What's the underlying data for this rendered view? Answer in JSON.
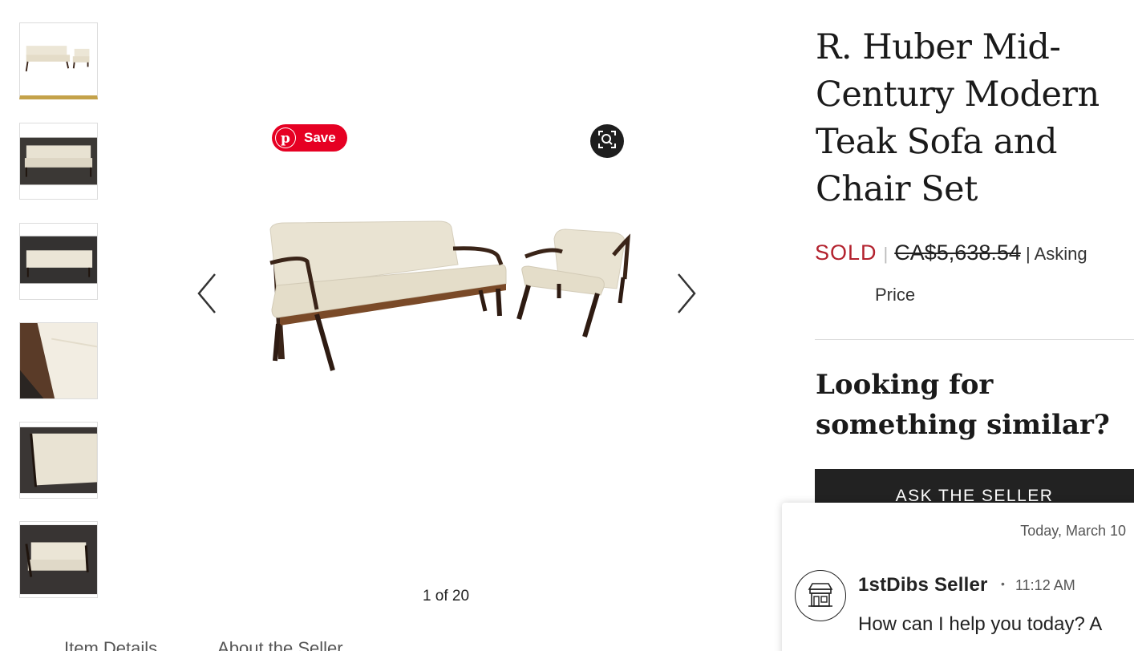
{
  "gallery": {
    "thumbnails": [
      {
        "label": "Sofa and chair set, white background",
        "active": true
      },
      {
        "label": "Sofa front view"
      },
      {
        "label": "Sofa flat view"
      },
      {
        "label": "Upholstery close-up"
      },
      {
        "label": "Sofa back detail"
      },
      {
        "label": "Sofa angle view"
      }
    ],
    "pinterest_save_label": "Save",
    "counter": "1 of 20",
    "tabs_peek": [
      "Item Details",
      "About the Seller"
    ]
  },
  "product": {
    "title": "R. Huber Mid-Century Modern Teak Sofa and Chair Set",
    "status": "SOLD",
    "price": "CA$5,638.54",
    "price_note_1": "| Asking",
    "price_note_2": "Price",
    "similar_heading": "Looking for something similar?",
    "ask_button": "ASK THE SELLER"
  },
  "chat": {
    "date": "Today, March 10",
    "seller_name": "1stDibs Seller",
    "dot": "•",
    "time": "11:12 AM",
    "message": "How can I help you today? A"
  },
  "colors": {
    "sold_red": "#b3222e",
    "pinterest_red": "#e60023",
    "active_thumb_gold": "#c4a24a",
    "button_dark": "#222222"
  },
  "icons": {
    "zoom": "zoom-magnifier-icon",
    "prev": "chevron-left-icon",
    "next": "chevron-right-icon",
    "pinterest": "pinterest-icon",
    "shop": "storefront-icon"
  }
}
